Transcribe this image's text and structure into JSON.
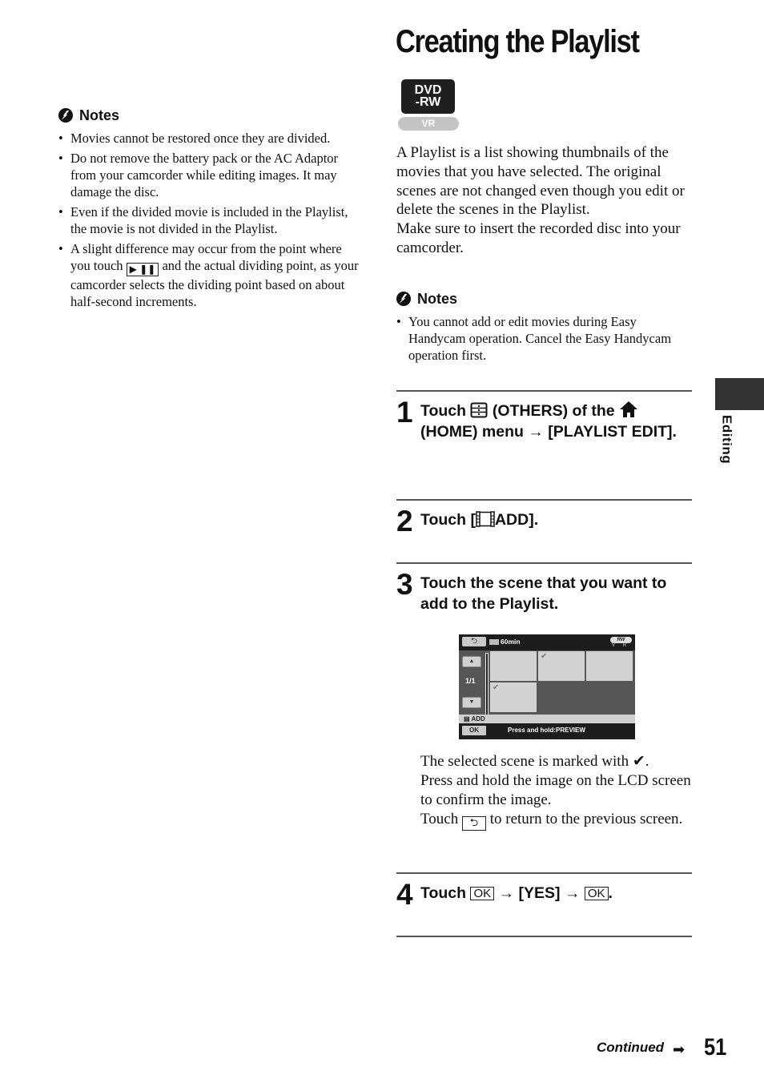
{
  "page": {
    "title": "Creating the Playlist",
    "badge": {
      "top": "DVD",
      "bottom": "-RW",
      "mode": "VR"
    },
    "side_tab_label": "Editing",
    "footer": {
      "continued": "Continued",
      "page_number": "51"
    }
  },
  "left_notes": {
    "heading": "Notes",
    "items": [
      "Movies cannot be restored once they are divided.",
      "Do not remove the battery pack or the AC Adaptor from your camcorder while editing images. It may damage the disc.",
      "Even if the divided movie is included in the Playlist, the movie is not divided in the Playlist."
    ],
    "item4": {
      "before": "A slight difference may occur from the point where you touch",
      "button_glyph": "▶ ❚❚",
      "after": "and the actual dividing point, as your camcorder selects the dividing point based on about half-second increments."
    }
  },
  "intro": {
    "p1": "A Playlist is a list showing thumbnails of the movies that you have selected. The original scenes are not changed even though you edit or delete the scenes in the Playlist.",
    "p2": "Make sure to insert the recorded disc into your camcorder."
  },
  "right_notes": {
    "heading": "Notes",
    "items": [
      "You cannot add or edit movies during Easy Handycam operation. Cancel the Easy Handycam operation first."
    ]
  },
  "steps": [
    {
      "num": "1",
      "t1": "Touch",
      "t2": "(OTHERS) of the",
      "t3": "(HOME) menu",
      "arrow": "→",
      "t4": "[PLAYLIST EDIT]."
    },
    {
      "num": "2",
      "t1": "Touch [",
      "t2": "ADD]."
    },
    {
      "num": "3",
      "text": "Touch the scene that you want to add to the Playlist."
    },
    {
      "num": "4",
      "t1": "Touch",
      "ok": "OK",
      "arrow": "→",
      "t2": "[YES]",
      "t3": "."
    }
  ],
  "lcd": {
    "back_glyph": "⮌",
    "remaining": "60min",
    "disc": "RW",
    "disc_mode": "V R",
    "page": "1/1",
    "up_glyph": "▲",
    "down_glyph": "▼",
    "check_glyph": "✔",
    "add_label": "ADD",
    "ok_label": "OK",
    "hint": "Press and hold:PREVIEW",
    "thumbnails": [
      {
        "selected": false
      },
      {
        "selected": true
      },
      {
        "selected": false
      },
      {
        "selected": true
      }
    ]
  },
  "step3_after": {
    "l1": "The selected scene is marked with",
    "check": "✔",
    "l2": "Press and hold the image on the LCD screen to confirm the image.",
    "l3a": "Touch",
    "back_glyph": "⮌",
    "l3b": "to return to the previous screen."
  }
}
